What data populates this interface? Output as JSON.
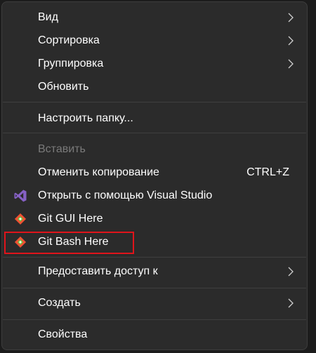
{
  "menu": {
    "items": [
      {
        "label": "Вид",
        "submenu": true
      },
      {
        "label": "Сортировка",
        "submenu": true
      },
      {
        "label": "Группировка",
        "submenu": true
      },
      {
        "label": "Обновить"
      },
      {
        "label": "Настроить папку..."
      },
      {
        "label": "Вставить",
        "disabled": true
      },
      {
        "label": "Отменить копирование",
        "shortcut": "CTRL+Z"
      },
      {
        "label": "Открыть с помощью Visual Studio",
        "icon": "visual-studio-icon"
      },
      {
        "label": "Git GUI Here",
        "icon": "git-icon"
      },
      {
        "label": "Git Bash Here",
        "icon": "git-icon",
        "highlighted": true
      },
      {
        "label": "Предоставить доступ к",
        "submenu": true
      },
      {
        "label": "Создать",
        "submenu": true
      },
      {
        "label": "Свойства"
      }
    ]
  },
  "colors": {
    "menu_background": "#2b2b2b",
    "text": "#ffffff",
    "disabled_text": "#7a7a7a",
    "highlight_border": "#e0141b",
    "visual_studio": "#8661c5",
    "git_orange": "#f05133"
  }
}
